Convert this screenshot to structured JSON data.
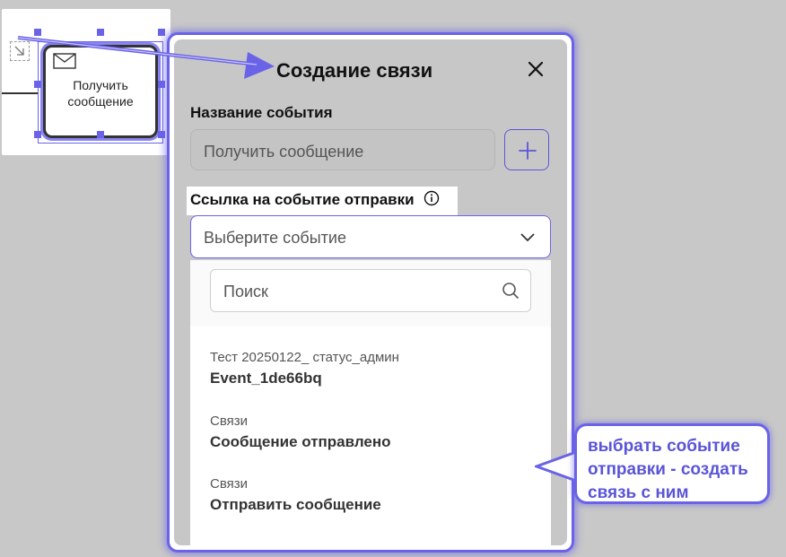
{
  "canvas": {
    "task_label": "Получить сообщение"
  },
  "dialog": {
    "title": "Создание связи",
    "event_name_label": "Название события",
    "event_name_value": "Получить сообщение",
    "send_link_label": "Ссылка на событие отправки",
    "select_placeholder": "Выберите событие",
    "search_placeholder": "Поиск",
    "options": [
      {
        "group": "Тест 20250122_ статус_админ",
        "title": "Event_1de66bq"
      },
      {
        "group": "Связи",
        "title": "Сообщение отправлено"
      },
      {
        "group": "Связи",
        "title": "Отправить сообщение"
      }
    ]
  },
  "annotation": {
    "callout_text": "выбрать событие отправки - создать связь с ним"
  },
  "colors": {
    "accent": "#6a63e8",
    "callout_text": "#5a55d6"
  }
}
